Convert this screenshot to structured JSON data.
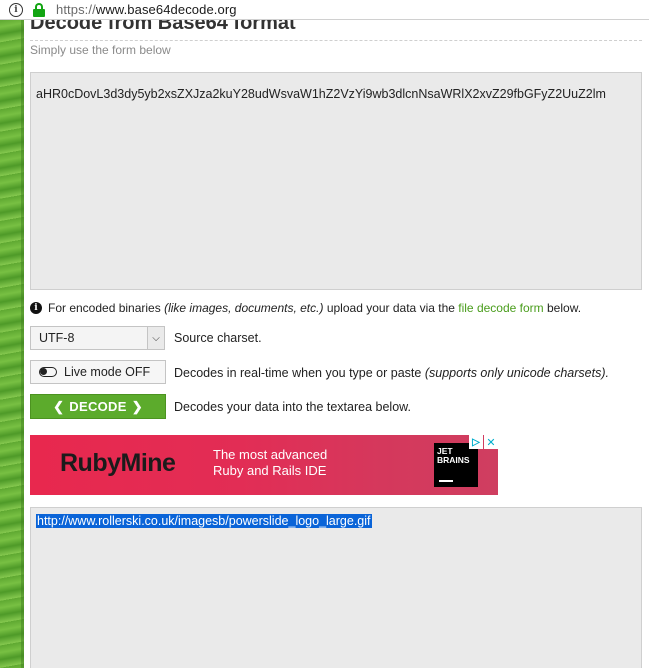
{
  "browser": {
    "url_scheme": "https://",
    "url_host": "www.base64decode.org"
  },
  "header": {
    "title": "Decode from Base64 format",
    "subtitle": "Simply use the form below"
  },
  "input": {
    "value": "aHR0cDovL3d3dy5yb2xsZXJza2kuY28udWsvaW1hZ2VzYi9wb3dlcnNsaWRlX2xvZ29fbGFyZ2UuZ2lm"
  },
  "note": {
    "prefix": "For encoded binaries",
    "italic": "(like images, documents, etc.)",
    "middle": "upload your data via the",
    "link": "file decode form",
    "suffix": "below."
  },
  "options": {
    "charset_value": "UTF-8",
    "charset_label": "Source charset.",
    "live_mode_label": "Live mode OFF",
    "live_mode_desc": "Decodes in real-time when you type or paste",
    "live_mode_desc_italic": "(supports only unicode charsets).",
    "decode_label": "DECODE",
    "decode_desc": "Decodes your data into the textarea below."
  },
  "ad": {
    "brand": "RubyMine",
    "tagline_line1": "The most advanced",
    "tagline_line2": "Ruby and Rails IDE",
    "logo_line1": "JET",
    "logo_line2": "BRAINS",
    "adchoices_icon": "adchoices-icon",
    "close_icon": "close-icon"
  },
  "output": {
    "value": "http://www.rollerski.co.uk/imagesb/powerslide_logo_large.gif"
  },
  "colors": {
    "accent_green": "#5cab2c",
    "link_green": "#4a9d1c",
    "selection_blue": "#0a64d8",
    "ad_red": "#e8284e"
  }
}
